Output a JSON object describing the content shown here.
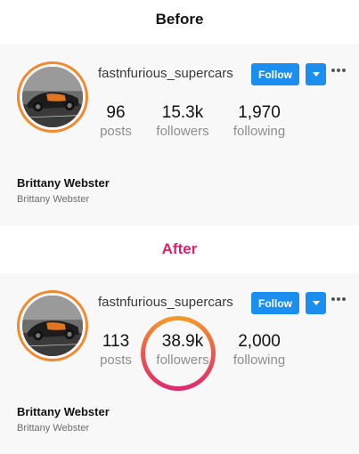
{
  "labels": {
    "before": "Before",
    "after": "After"
  },
  "before": {
    "username": "fastnfurious_supercars",
    "follow_label": "Follow",
    "stats": {
      "posts": "96",
      "followers": "15.3k",
      "following": "1,970"
    },
    "full_name": "Brittany Webster",
    "bio": "Brittany Webster"
  },
  "after": {
    "username": "fastnfurious_supercars",
    "follow_label": "Follow",
    "stats": {
      "posts": "113",
      "followers": "38.9k",
      "following": "2,000"
    },
    "full_name": "Brittany Webster",
    "bio": "Brittany Webster"
  },
  "stat_labels": {
    "posts": "posts",
    "followers": "followers",
    "following": "following"
  },
  "colors": {
    "follow_button": "#1a8ff0",
    "avatar_ring": "#f18a2e",
    "after_title": "#d6246e",
    "highlight_start": "#f39c26",
    "highlight_end": "#dc2a6f"
  },
  "icons": {
    "dropdown": "caret-down-icon",
    "more": "ellipsis-icon"
  }
}
